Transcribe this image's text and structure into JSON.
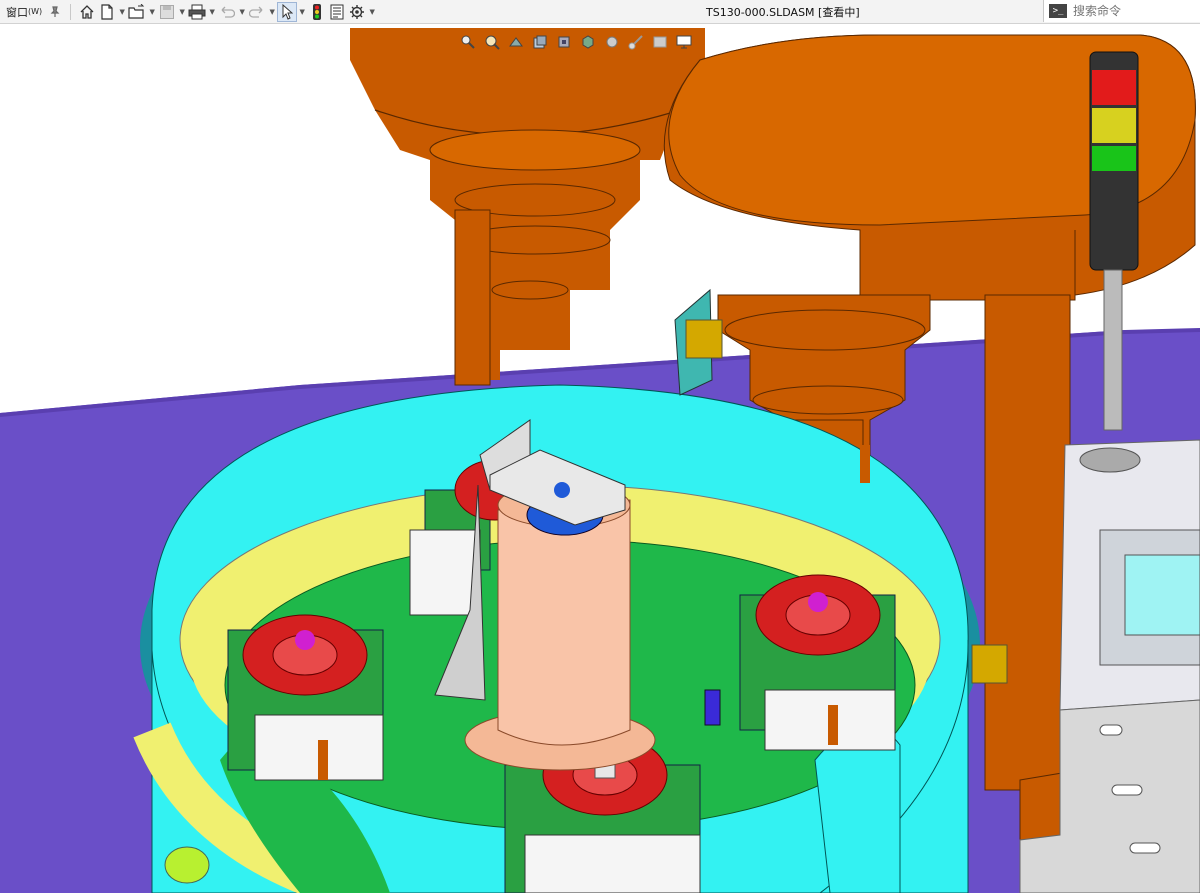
{
  "toolbar": {
    "window_menu": "窗口",
    "window_menu_accel": "(W)",
    "document_title": "TS130-000.SLDASM [查看中]",
    "search_placeholder": "搜索命令"
  },
  "icons": [
    "pin-icon",
    "home-icon",
    "new-document-icon",
    "open-folder-icon",
    "save-icon",
    "print-icon",
    "undo-icon",
    "redo-icon",
    "select-arrow-icon",
    "traffic-light-icon",
    "file-properties-icon",
    "options-gear-icon",
    "terminal-icon",
    "zoom-to-fit-icon",
    "zoom-area-icon",
    "previous-view-icon",
    "section-view-icon",
    "view-orientation-icon",
    "display-style-icon",
    "hide-show-icon",
    "edit-appearance-icon",
    "apply-scene-icon",
    "view-settings-icon"
  ],
  "colors": {
    "machine_orange": "#c85a00",
    "table_purple": "#6a4fc8",
    "bowl_cyan": "#33f2f2",
    "bowl_yellow": "#f0f070",
    "plate_green": "#1fb84a",
    "wheel_red": "#d42020",
    "tube_copper": "#f4b896"
  }
}
